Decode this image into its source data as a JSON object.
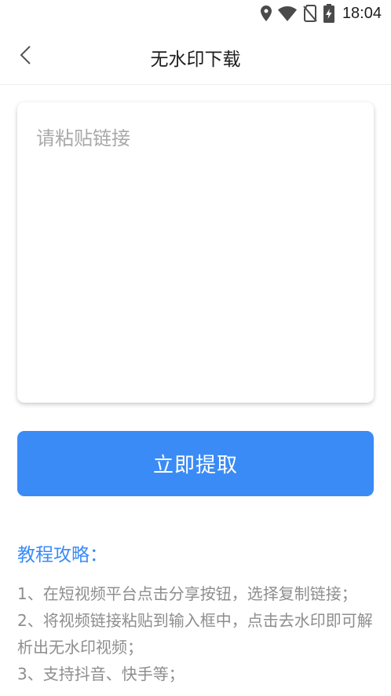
{
  "status_bar": {
    "time": "18:04",
    "icons": [
      "location-icon",
      "wifi-icon",
      "no-sim-icon",
      "battery-charging-icon"
    ]
  },
  "nav": {
    "back_icon": "chevron-left-icon",
    "title": "无水印下载"
  },
  "link_box": {
    "placeholder": "请粘贴链接",
    "value": ""
  },
  "extract_button": {
    "label": "立即提取"
  },
  "tutorial": {
    "title": "教程攻略：",
    "steps": [
      "1、在短视频平台点击分享按钮，选择复制链接；",
      "2、将视频链接粘贴到输入框中，点击去水印即可解析出无水印视频；",
      "3、支持抖音、快手等；"
    ]
  },
  "colors": {
    "accent": "#3a8bf6",
    "placeholder": "#a9a9a9",
    "step_text": "#8e8e8e"
  }
}
